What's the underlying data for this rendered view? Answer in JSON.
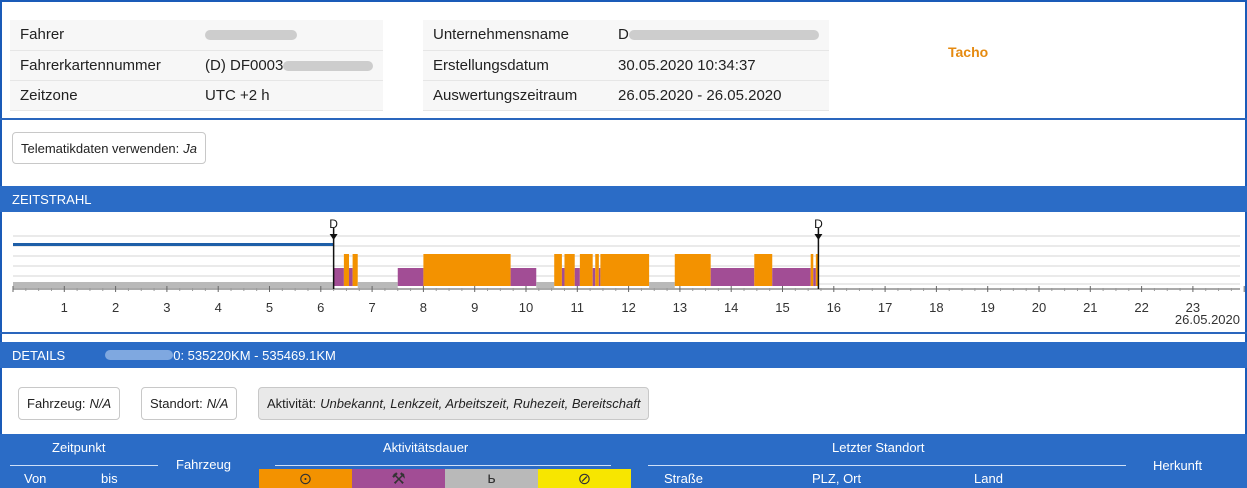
{
  "header": {
    "rows_left": [
      {
        "key": "Fahrer",
        "value": ""
      },
      {
        "key": "Fahrerkartennummer",
        "value": "(D) DF0003"
      },
      {
        "key": "Zeitzone",
        "value": "UTC +2 h"
      }
    ],
    "rows_right": [
      {
        "key": "Unternehmensname",
        "value": "D"
      },
      {
        "key": "Erstellungsdatum",
        "value": "30.05.2020 10:34:37"
      },
      {
        "key": "Auswertungszeitraum",
        "value": "26.05.2020 - 26.05.2020"
      }
    ],
    "tacho_label": "Tacho"
  },
  "telematik": {
    "label": "Telematikdaten verwenden:",
    "value": "Ja"
  },
  "zeitstrahl": {
    "title": "ZEITSTRAHL",
    "hours": [
      "1",
      "2",
      "3",
      "4",
      "5",
      "6",
      "7",
      "8",
      "9",
      "10",
      "11",
      "12",
      "13",
      "14",
      "15",
      "16",
      "17",
      "18",
      "19",
      "20",
      "21",
      "22",
      "23"
    ],
    "date_label": "26.05.2020",
    "marker_label": "D",
    "markers_hours": [
      6.25,
      15.7
    ],
    "colors": {
      "lenkzeit": "#f39200",
      "arbeitszeit": "#a24d95",
      "ruhezeit": "#b9b9b9",
      "bereitschaft": "#f7e600",
      "unknown_line": "#1e5fa8"
    },
    "segments": [
      {
        "type": "unknown",
        "from": 0,
        "to": 6.25
      },
      {
        "type": "ruhezeit",
        "from": 0,
        "to": 6.25
      },
      {
        "type": "arbeitszeit",
        "from": 6.25,
        "to": 6.45
      },
      {
        "type": "lenkzeit",
        "from": 6.45,
        "to": 6.55
      },
      {
        "type": "arbeitszeit",
        "from": 6.55,
        "to": 6.62
      },
      {
        "type": "lenkzeit",
        "from": 6.62,
        "to": 6.72
      },
      {
        "type": "ruhezeit",
        "from": 6.72,
        "to": 7.5
      },
      {
        "type": "arbeitszeit",
        "from": 7.5,
        "to": 8.0
      },
      {
        "type": "lenkzeit",
        "from": 8.0,
        "to": 9.7
      },
      {
        "type": "arbeitszeit",
        "from": 9.7,
        "to": 10.2
      },
      {
        "type": "ruhezeit",
        "from": 10.2,
        "to": 10.55
      },
      {
        "type": "lenkzeit",
        "from": 10.55,
        "to": 10.7
      },
      {
        "type": "arbeitszeit",
        "from": 10.7,
        "to": 10.75
      },
      {
        "type": "lenkzeit",
        "from": 10.75,
        "to": 10.95
      },
      {
        "type": "arbeitszeit",
        "from": 10.95,
        "to": 11.05
      },
      {
        "type": "lenkzeit",
        "from": 11.05,
        "to": 11.3
      },
      {
        "type": "arbeitszeit",
        "from": 11.3,
        "to": 11.35
      },
      {
        "type": "lenkzeit",
        "from": 11.35,
        "to": 11.42
      },
      {
        "type": "arbeitszeit",
        "from": 11.42,
        "to": 11.45
      },
      {
        "type": "lenkzeit",
        "from": 11.45,
        "to": 12.4
      },
      {
        "type": "ruhezeit",
        "from": 12.4,
        "to": 12.9
      },
      {
        "type": "lenkzeit",
        "from": 12.9,
        "to": 13.6
      },
      {
        "type": "arbeitszeit",
        "from": 13.6,
        "to": 14.45
      },
      {
        "type": "lenkzeit",
        "from": 14.45,
        "to": 14.8
      },
      {
        "type": "arbeitszeit",
        "from": 14.8,
        "to": 15.55
      },
      {
        "type": "lenkzeit",
        "from": 15.55,
        "to": 15.6
      },
      {
        "type": "arbeitszeit",
        "from": 15.6,
        "to": 15.65
      },
      {
        "type": "lenkzeit",
        "from": 15.65,
        "to": 15.7
      }
    ]
  },
  "details": {
    "title": "DETAILS",
    "range": "0: 535220KM - 535469.1KM"
  },
  "filters": {
    "fahrzeug_label": "Fahrzeug:",
    "fahrzeug_value": "N/A",
    "standort_label": "Standort:",
    "standort_value": "N/A",
    "aktivitaet_label": "Aktivität:",
    "aktivitaet_value": "Unbekannt, Lenkzeit, Arbeitszeit, Ruhezeit, Bereitschaft"
  },
  "table_header": {
    "zeitpunkt": "Zeitpunkt",
    "von": "Von",
    "bis": "bis",
    "fahrzeug": "Fahrzeug",
    "aktivitaetsdauer": "Aktivitätsdauer",
    "letzter_standort": "Letzter Standort",
    "strasse": "Straße",
    "plz_ort": "PLZ, Ort",
    "land": "Land",
    "herkunft": "Herkunft",
    "activity_icons": [
      {
        "name": "lenkzeit-icon",
        "glyph": "⊙",
        "color": "#f39200"
      },
      {
        "name": "arbeitszeit-icon",
        "glyph": "⚒",
        "color": "#a24d95"
      },
      {
        "name": "ruhezeit-icon",
        "glyph": "ь",
        "color": "#b9b9b9"
      },
      {
        "name": "bereitschaft-icon",
        "glyph": "⊘",
        "color": "#f7e600"
      }
    ]
  }
}
